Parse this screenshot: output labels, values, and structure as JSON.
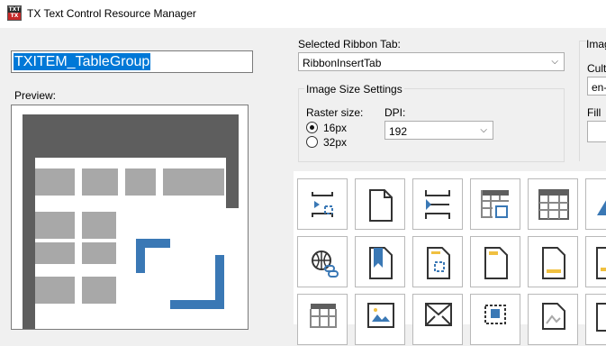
{
  "window": {
    "title": "TX Text Control Resource Manager",
    "icon_top": "TXT",
    "icon_bottom": "TX"
  },
  "resource_name": "TXITEM_TableGroup",
  "preview_label": "Preview:",
  "ribbon": {
    "label": "Selected Ribbon Tab:",
    "value": "RibbonInsertTab"
  },
  "image_size": {
    "title": "Image Size Settings",
    "raster_label": "Raster size:",
    "options": [
      "16px",
      "32px"
    ],
    "selected": "16px",
    "dpi_label": "DPI:",
    "dpi_value": "192"
  },
  "right_panel": {
    "title": "Imag",
    "culture_label": "Cultu",
    "culture_value": "en-",
    "fill_label": "Fill C"
  },
  "icons": [
    "cursor-insert-icon",
    "blank-page-icon",
    "cursor-split-icon",
    "table-insert-icon",
    "table-icon",
    "image-icon",
    "globe-link-icon",
    "bookmark-icon",
    "page-frame-icon",
    "page-header-icon",
    "page-footer-icon",
    "image-page-icon",
    "table-small-icon",
    "picture-icon",
    "envelope-icon",
    "frame-select-icon",
    "shape-icon",
    "page-icon"
  ],
  "colors": {
    "accent": "#0078d7",
    "icon_blue": "#3a78b5",
    "icon_yellow": "#f0c040",
    "preview_dark": "#5e5e5e",
    "preview_gray": "#a8a8a8"
  }
}
